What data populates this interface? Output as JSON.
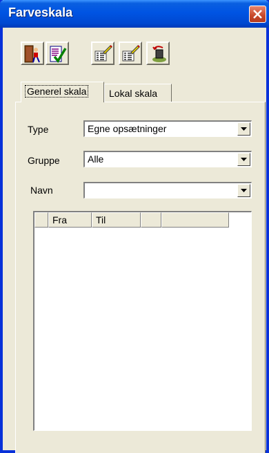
{
  "window": {
    "title": "Farveskala"
  },
  "toolbar": {
    "buttons": [
      {
        "name": "exit-button",
        "icon": "exit-door-icon"
      },
      {
        "name": "apply-button",
        "icon": "checklist-icon"
      },
      {
        "name": "edit-scale-button",
        "icon": "edit-list-icon"
      },
      {
        "name": "edit-scale-2-button",
        "icon": "edit-list-icon"
      },
      {
        "name": "reset-button",
        "icon": "undo-bucket-icon"
      }
    ]
  },
  "tabs": [
    {
      "label": "Generel skala",
      "active": true
    },
    {
      "label": "Lokal skala",
      "active": false
    }
  ],
  "form": {
    "type": {
      "label": "Type",
      "value": "Egne opsætninger"
    },
    "gruppe": {
      "label": "Gruppe",
      "value": "Alle"
    },
    "navn": {
      "label": "Navn",
      "value": ""
    }
  },
  "grid": {
    "columns": [
      "",
      "Fra",
      "Til",
      "",
      ""
    ],
    "rows": []
  },
  "colors": {
    "titlebar": "#0054E3",
    "face": "#ECE9D8",
    "close": "#C7482A"
  }
}
